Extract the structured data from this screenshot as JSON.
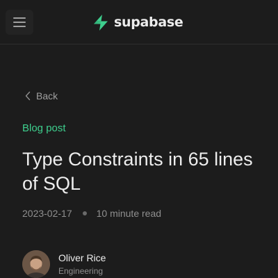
{
  "navbar": {
    "menu_icon": "hamburger-menu-icon",
    "logo_icon": "supabase-bolt-icon",
    "logo_text": "supabase"
  },
  "back": {
    "icon": "chevron-left-icon",
    "label": "Back"
  },
  "post": {
    "category": "Blog post",
    "title": "Type Constraints in 65 lines of SQL",
    "date": "2023-02-17",
    "read_time": "10 minute read"
  },
  "author": {
    "name": "Oliver Rice",
    "role": "Engineering"
  },
  "colors": {
    "background": "#1c1c1c",
    "brand": "#3ecf8e",
    "text": "#ededed",
    "muted": "#8f8f8f"
  }
}
